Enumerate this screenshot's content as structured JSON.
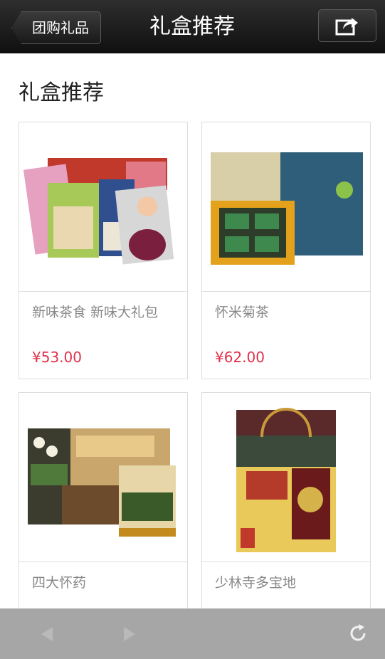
{
  "header": {
    "back_label": "团购礼品",
    "title": "礼盒推荐",
    "share_icon": "share-icon"
  },
  "section": {
    "title": "礼盒推荐"
  },
  "products": [
    {
      "name": "新味茶食 新味大礼包",
      "price": "¥53.00"
    },
    {
      "name": "怀米菊茶",
      "price": "¥62.00"
    },
    {
      "name": "四大怀药",
      "price": ""
    },
    {
      "name": "少林寺多宝地",
      "price": ""
    }
  ],
  "bottom_bar": {
    "back_icon": "arrow-left-icon",
    "forward_icon": "arrow-right-icon",
    "refresh_icon": "refresh-icon"
  },
  "colors": {
    "price": "#e0304a",
    "topbar": "#1b1b1b",
    "bottombar": "#a6a6a6"
  }
}
